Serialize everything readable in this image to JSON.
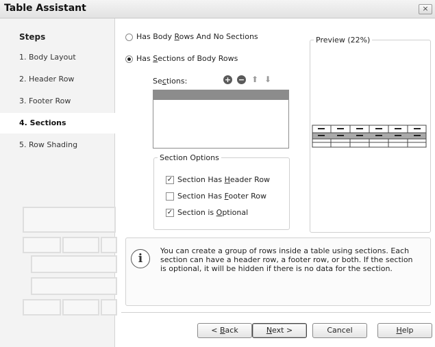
{
  "window": {
    "title": "Table Assistant",
    "close": "×"
  },
  "steps": {
    "title": "Steps",
    "items": [
      "1. Body Layout",
      "2. Header Row",
      "3. Footer Row",
      "4. Sections",
      "5. Row Shading"
    ],
    "active_index": 3
  },
  "options": {
    "no_sections_label": "Has Body Rows And No Sections",
    "sections_label": "Has Sections of Body Rows",
    "selected": "sections"
  },
  "sections": {
    "label": "Sections:",
    "add": "+",
    "remove": "−",
    "up": "⬆",
    "down": "⬇"
  },
  "section_options": {
    "title": "Section Options",
    "items": [
      {
        "label": "Section Has Header Row",
        "checked": true
      },
      {
        "label": "Section Has Footer Row",
        "checked": false
      },
      {
        "label": "Section is Optional",
        "checked": true
      }
    ]
  },
  "preview": {
    "title": "Preview (22%)"
  },
  "info": {
    "text": "You can create a group of rows inside a table using sections. Each section can have a header row, a footer row, or both. If the section is optional, it will be hidden if there is no data for the section."
  },
  "buttons": {
    "back": "< Back",
    "next": "Next >",
    "cancel": "Cancel",
    "help": "Help"
  }
}
